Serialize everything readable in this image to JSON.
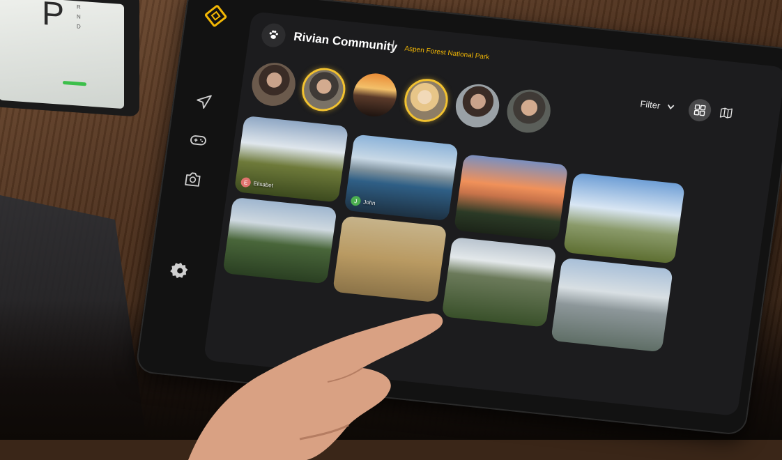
{
  "app": {
    "title": "Rivian Community",
    "separator": "|",
    "location": "Aspen Forest National Park",
    "accent_color": "#f2b705"
  },
  "cluster": {
    "gear": "P",
    "gear_list": [
      "R",
      "N",
      "D"
    ]
  },
  "sidebar": {
    "items": [
      {
        "icon": "navigation-arrow-icon"
      },
      {
        "icon": "gamepad-icon"
      },
      {
        "icon": "camera-rotate-icon"
      },
      {
        "icon": "gear-icon"
      }
    ]
  },
  "toolbar": {
    "filter_label": "Filter",
    "views": [
      {
        "icon": "grid-view-icon",
        "selected": true
      },
      {
        "icon": "map-view-icon",
        "selected": false
      }
    ]
  },
  "avatars": [
    {
      "highlighted": false
    },
    {
      "highlighted": true
    },
    {
      "highlighted": false
    },
    {
      "highlighted": true
    },
    {
      "highlighted": false
    },
    {
      "highlighted": false
    }
  ],
  "photos": [
    {
      "subject": "hare in meadow",
      "user_initial": "E",
      "user_name": "Elisabet",
      "initial_color": "#e0736e"
    },
    {
      "subject": "couple kayaking",
      "user_initial": "J",
      "user_name": "John",
      "initial_color": "#4caf50"
    },
    {
      "subject": "sunset lake forest"
    },
    {
      "subject": "mountain meadow clouds"
    },
    {
      "subject": "hiker over lake valley"
    },
    {
      "subject": "deer in grass"
    },
    {
      "subject": "rock spires forest"
    },
    {
      "subject": "hiker by river"
    }
  ]
}
